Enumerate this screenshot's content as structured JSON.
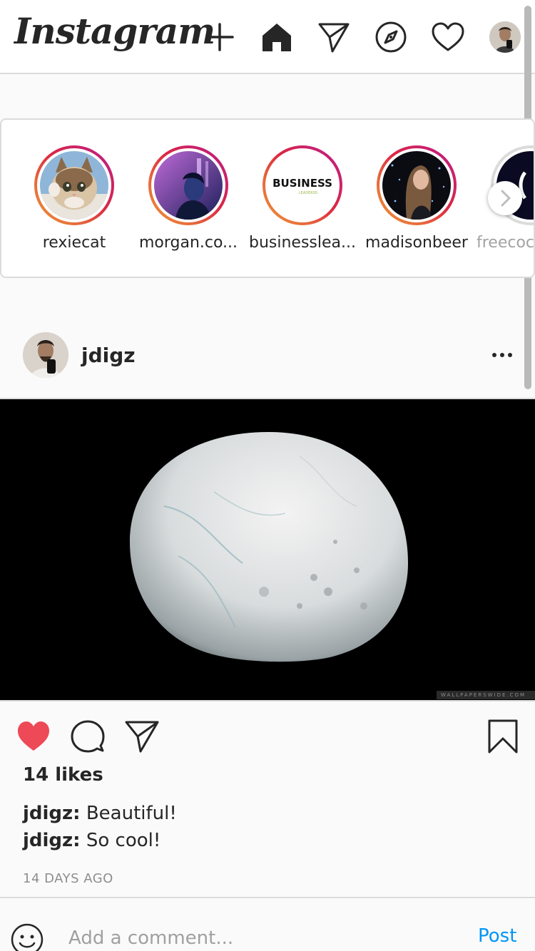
{
  "app": {
    "logo_text": "Instagram"
  },
  "nav": {
    "icons": [
      "plus-icon",
      "home-icon",
      "direct-send-icon",
      "explore-compass-icon",
      "heart-icon",
      "profile-avatar"
    ]
  },
  "stories": [
    {
      "username": "rexiecat"
    },
    {
      "username": "morgan.co..."
    },
    {
      "username": "businesslea..."
    },
    {
      "username": "madisonbeer"
    },
    {
      "username": "freecoc"
    }
  ],
  "story_logo_text": {
    "top": "BUS",
    "mid": "NESS",
    "sub": "LEADERSS"
  },
  "post": {
    "username": "jdigz",
    "likes": "14 likes",
    "comments": [
      {
        "user": "jdigz:",
        "text": " Beautiful!"
      },
      {
        "user": "jdigz:",
        "text": " So cool!"
      }
    ],
    "time": "14 DAYS AGO",
    "watermark": "WALLPAPERSWIDE.COM"
  },
  "comment_box": {
    "placeholder": "Add a comment...",
    "post_label": "Post"
  },
  "colors": {
    "like_red": "#ed4956",
    "link_blue": "#0095f6",
    "border": "#dbdbdb"
  }
}
